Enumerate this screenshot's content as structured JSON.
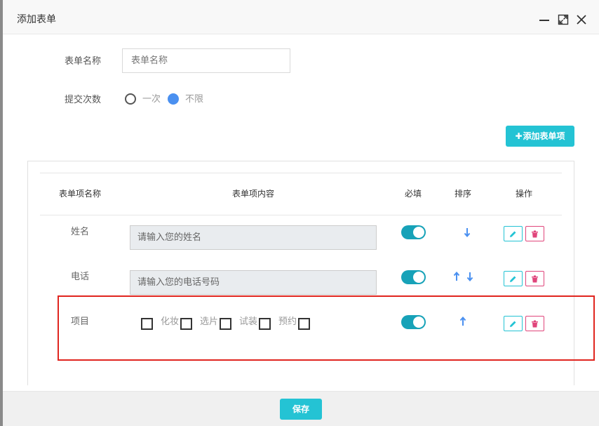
{
  "dialog": {
    "title": "添加表单"
  },
  "form": {
    "name_label": "表单名称",
    "name_placeholder": "表单名称",
    "submit_count_label": "提交次数",
    "options": [
      {
        "label": "一次",
        "selected": false
      },
      {
        "label": "不限",
        "selected": true
      }
    ]
  },
  "toolbar": {
    "add_item_plus": "✚",
    "add_item_label": "添加表单项"
  },
  "table": {
    "headers": {
      "name": "表单项名称",
      "content": "表单项内容",
      "required": "必填",
      "sort": "排序",
      "action": "操作"
    },
    "rows": [
      {
        "name": "姓名",
        "placeholder": "请输入您的姓名",
        "required": true,
        "sort": [
          "down"
        ]
      },
      {
        "name": "电话",
        "placeholder": "请输入您的电话号码",
        "required": true,
        "sort": [
          "up",
          "down"
        ]
      },
      {
        "name": "项目",
        "choices": [
          "化妆",
          "选片",
          "试装",
          "预约"
        ],
        "required": true,
        "sort": [
          "up"
        ]
      }
    ]
  },
  "footer": {
    "save_label": "保存"
  },
  "colors": {
    "accent": "#24c3d4",
    "toggle_on": "#17a2b8",
    "radio_selected": "#4a90f0",
    "arrow": "#4a90f0",
    "delete": "#e0457b",
    "highlight_border": "#e0251f"
  },
  "icons": {
    "window_controls": [
      "minimize-icon",
      "maximize-icon",
      "close-icon"
    ],
    "row_actions": [
      "pencil-icon",
      "trash-icon"
    ],
    "sort": [
      "arrow-up-icon",
      "arrow-down-icon"
    ]
  }
}
